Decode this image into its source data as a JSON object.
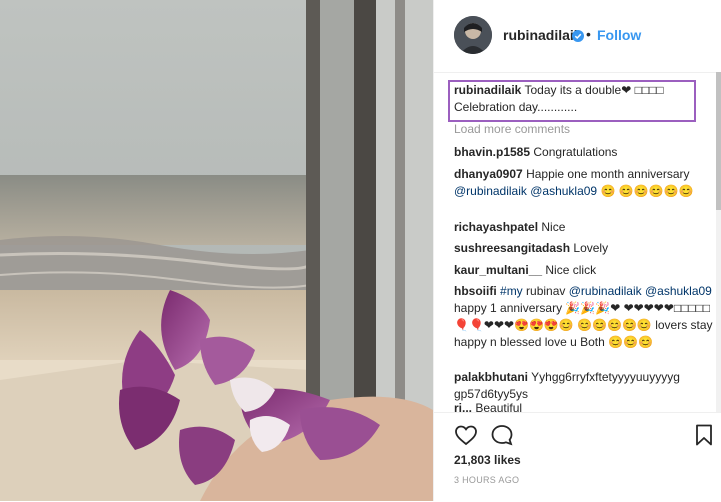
{
  "post": {
    "username": "rubinadilaik",
    "follow_label": "Follow",
    "separator": "•",
    "caption_text": "Today its a double❤ □□□□ Celebration day............",
    "load_more": "Load more comments",
    "likes": "21,803 likes",
    "time_ago": "3 HOURS AGO"
  },
  "comments": [
    {
      "user": "bhavin.p1585",
      "text": "Congratulations"
    },
    {
      "user": "dhanya0907",
      "text": "Happie one month anniversary",
      "mentions": "@rubinadilaik @ashukla09",
      "tail": "😊 😊😊😊😊😊"
    },
    {
      "user": "richayashpatel",
      "text": "Nice"
    },
    {
      "user": "sushreesangitadash",
      "text": "Lovely"
    },
    {
      "user": "kaur_multani__",
      "text": "Nice click"
    },
    {
      "user": "hbsoiifi",
      "tag": "#my",
      "text": "rubinav",
      "mention1": "@rubinadilaik",
      "mention2": "@ashukla09",
      "text2": "happy 1 anniversary 🎉🎉🎉❤ ❤❤❤❤❤□□□□□🎈🎈❤❤❤😍😍😍😊 😊😊😊😊😊 lovers stay happy n blessed love u Both 😊😊😊"
    },
    {
      "user": "palakbhutani",
      "text": "Yyhgg6rryfxftetyyyyuuyyyyg gp57d6tyy5ys"
    },
    {
      "user": "ri...",
      "text": "Beautiful"
    }
  ],
  "colors": {
    "follow": "#3897f0",
    "verified": "#3897f0",
    "highlight": "#9b5fbf",
    "mention": "#003569"
  },
  "icons": {
    "like": "heart-outline-icon",
    "comment": "speech-bubble-icon",
    "save": "bookmark-icon",
    "verified": "verified-badge-icon"
  }
}
